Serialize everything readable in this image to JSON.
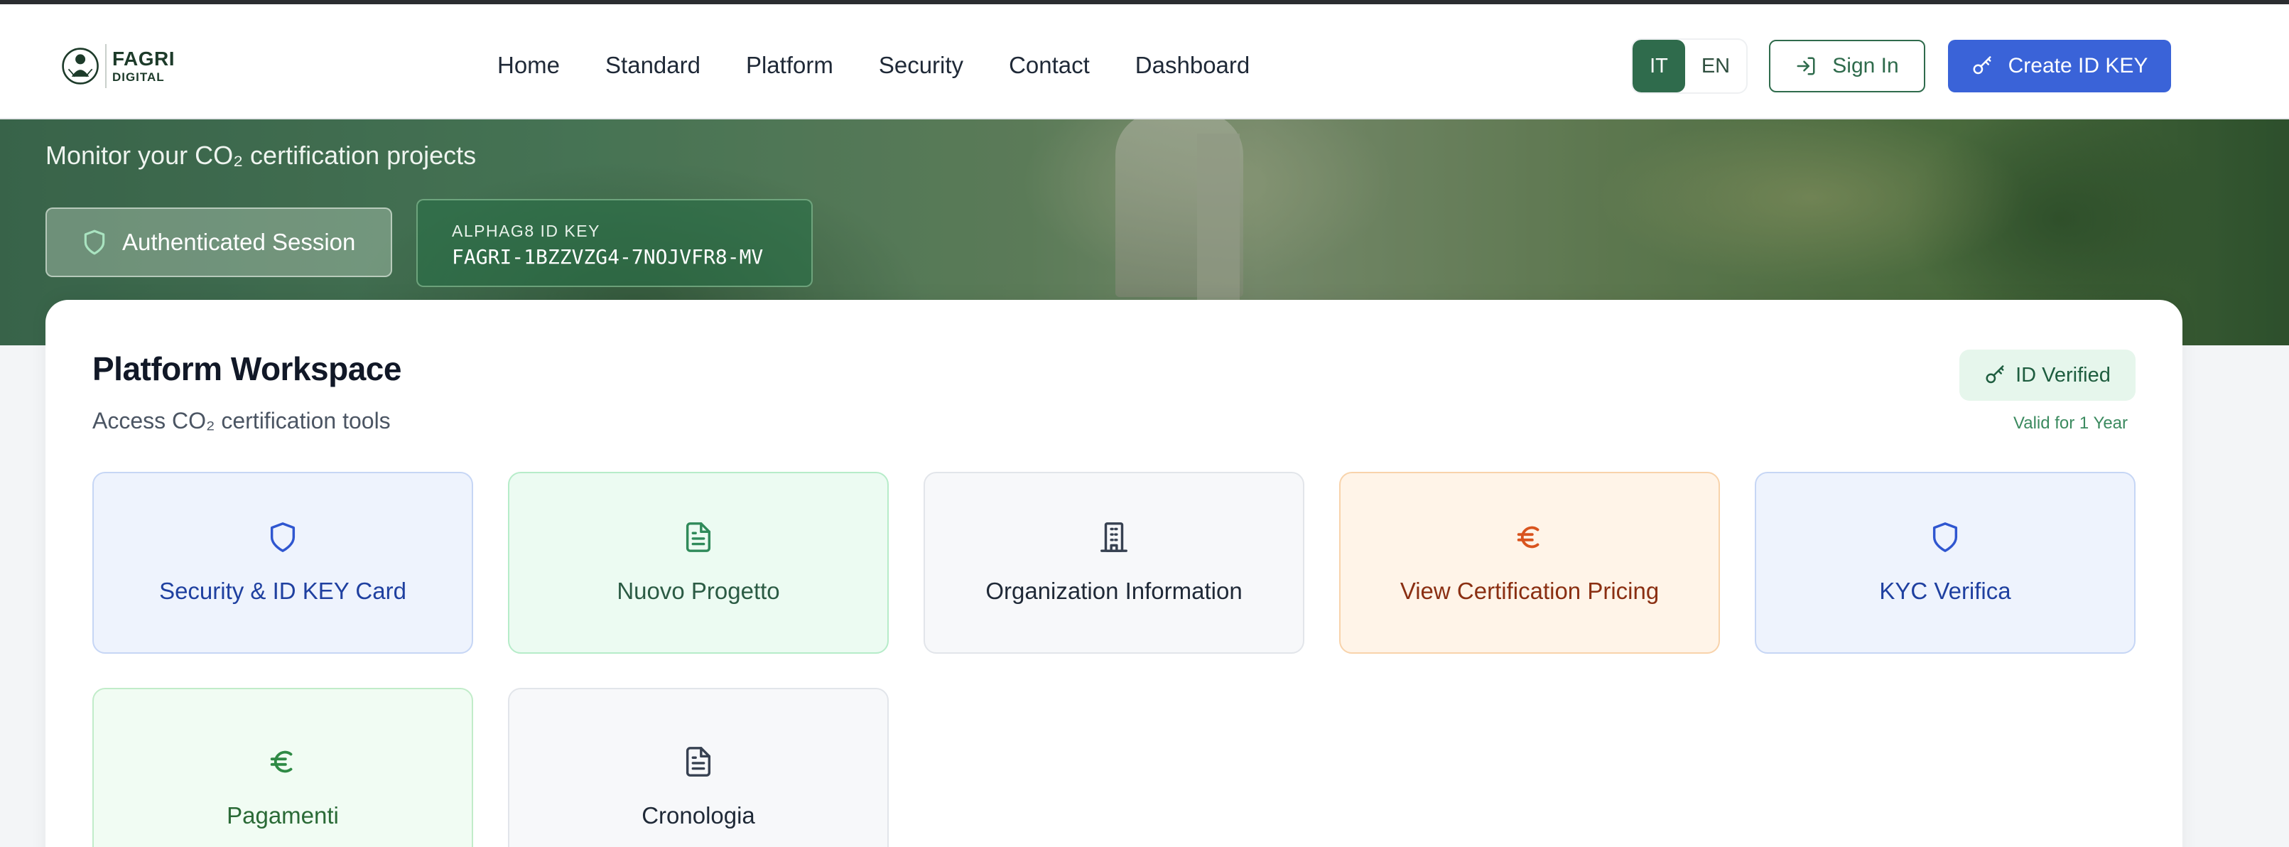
{
  "brand": {
    "line1": "FAGRI",
    "line2": "DIGITAL"
  },
  "nav": [
    "Home",
    "Standard",
    "Platform",
    "Security",
    "Contact",
    "Dashboard"
  ],
  "lang": {
    "it": "IT",
    "en": "EN"
  },
  "header": {
    "sign_in": "Sign In",
    "create_id": "Create ID KEY"
  },
  "hero": {
    "subtitle": "Monitor your CO₂ certification projects",
    "session": "Authenticated Session",
    "id_key_label": "ALPHAG8 ID KEY",
    "id_key_value": "FAGRI-1BZZVZG4-7NOJVFR8-MV"
  },
  "workspace": {
    "title": "Platform Workspace",
    "subtitle": "Access CO₂ certification tools",
    "badge": "ID Verified",
    "valid": "Valid for 1 Year"
  },
  "tiles": [
    {
      "label": "Security & ID KEY Card",
      "icon": "shield-icon"
    },
    {
      "label": "Nuovo Progetto",
      "icon": "document-icon"
    },
    {
      "label": "Organization Information",
      "icon": "building-icon"
    },
    {
      "label": "View Certification Pricing",
      "icon": "euro-icon"
    },
    {
      "label": "KYC Verifica",
      "icon": "shield-icon"
    },
    {
      "label": "Pagamenti",
      "icon": "euro-icon"
    },
    {
      "label": "Cronologia",
      "icon": "document-icon"
    }
  ],
  "colors": {
    "primary_green": "#2f6b4c",
    "primary_blue": "#3a63d8",
    "orange_icon": "#d9541e"
  }
}
